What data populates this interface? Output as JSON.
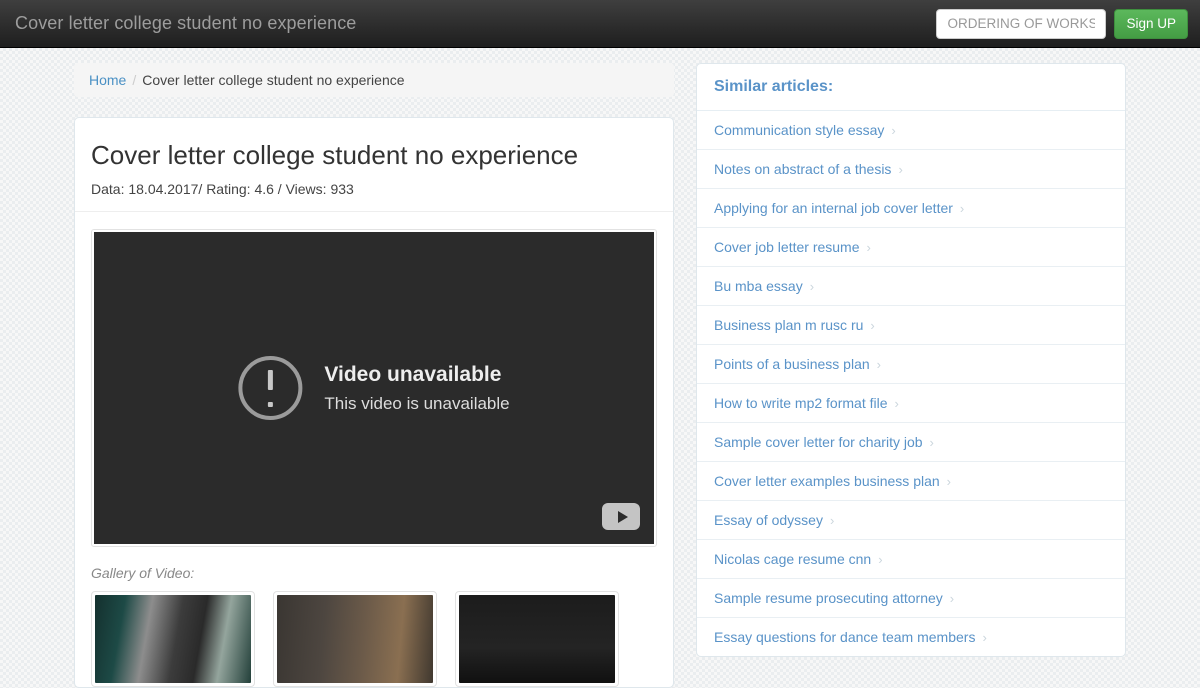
{
  "navbar": {
    "brand": "Cover letter college student no experience",
    "search_placeholder": "ORDERING OF WORKS",
    "search_value": "",
    "signup_label": "Sign UP"
  },
  "breadcrumb": {
    "home": "Home",
    "separator": "/",
    "current": "Cover letter college student no experience"
  },
  "article": {
    "title": "Cover letter college student no experience",
    "meta": "Data: 18.04.2017/ Rating: 4.6 / Views: 933",
    "video": {
      "title": "Video unavailable",
      "subtitle": "This video is unavailable",
      "alert_icon": "exclamation-circle-icon",
      "logo_icon": "youtube-play-icon"
    },
    "gallery_label": "Gallery of Video:"
  },
  "sidebar": {
    "heading": "Similar articles:",
    "chevron": "›",
    "items": [
      {
        "label": "Communication style essay"
      },
      {
        "label": "Notes on abstract of a thesis"
      },
      {
        "label": "Applying for an internal job cover letter"
      },
      {
        "label": "Cover job letter resume"
      },
      {
        "label": "Bu mba essay"
      },
      {
        "label": "Business plan m rusc ru"
      },
      {
        "label": "Points of a business plan"
      },
      {
        "label": "How to write mp2 format file"
      },
      {
        "label": "Sample cover letter for charity job"
      },
      {
        "label": "Cover letter examples business plan"
      },
      {
        "label": "Essay of odyssey"
      },
      {
        "label": "Nicolas cage resume cnn"
      },
      {
        "label": "Sample resume prosecuting attorney"
      },
      {
        "label": "Essay questions for dance team members"
      }
    ]
  },
  "colors": {
    "navbar_dark": "#2b2b2b",
    "brand_text": "#9d9d9d",
    "accent_green": "#5cb85c",
    "link_blue": "#5a93c8",
    "page_bg": "#f7f7f7",
    "panel_border": "#dfe7ec",
    "video_bg": "#2b2b2b"
  }
}
